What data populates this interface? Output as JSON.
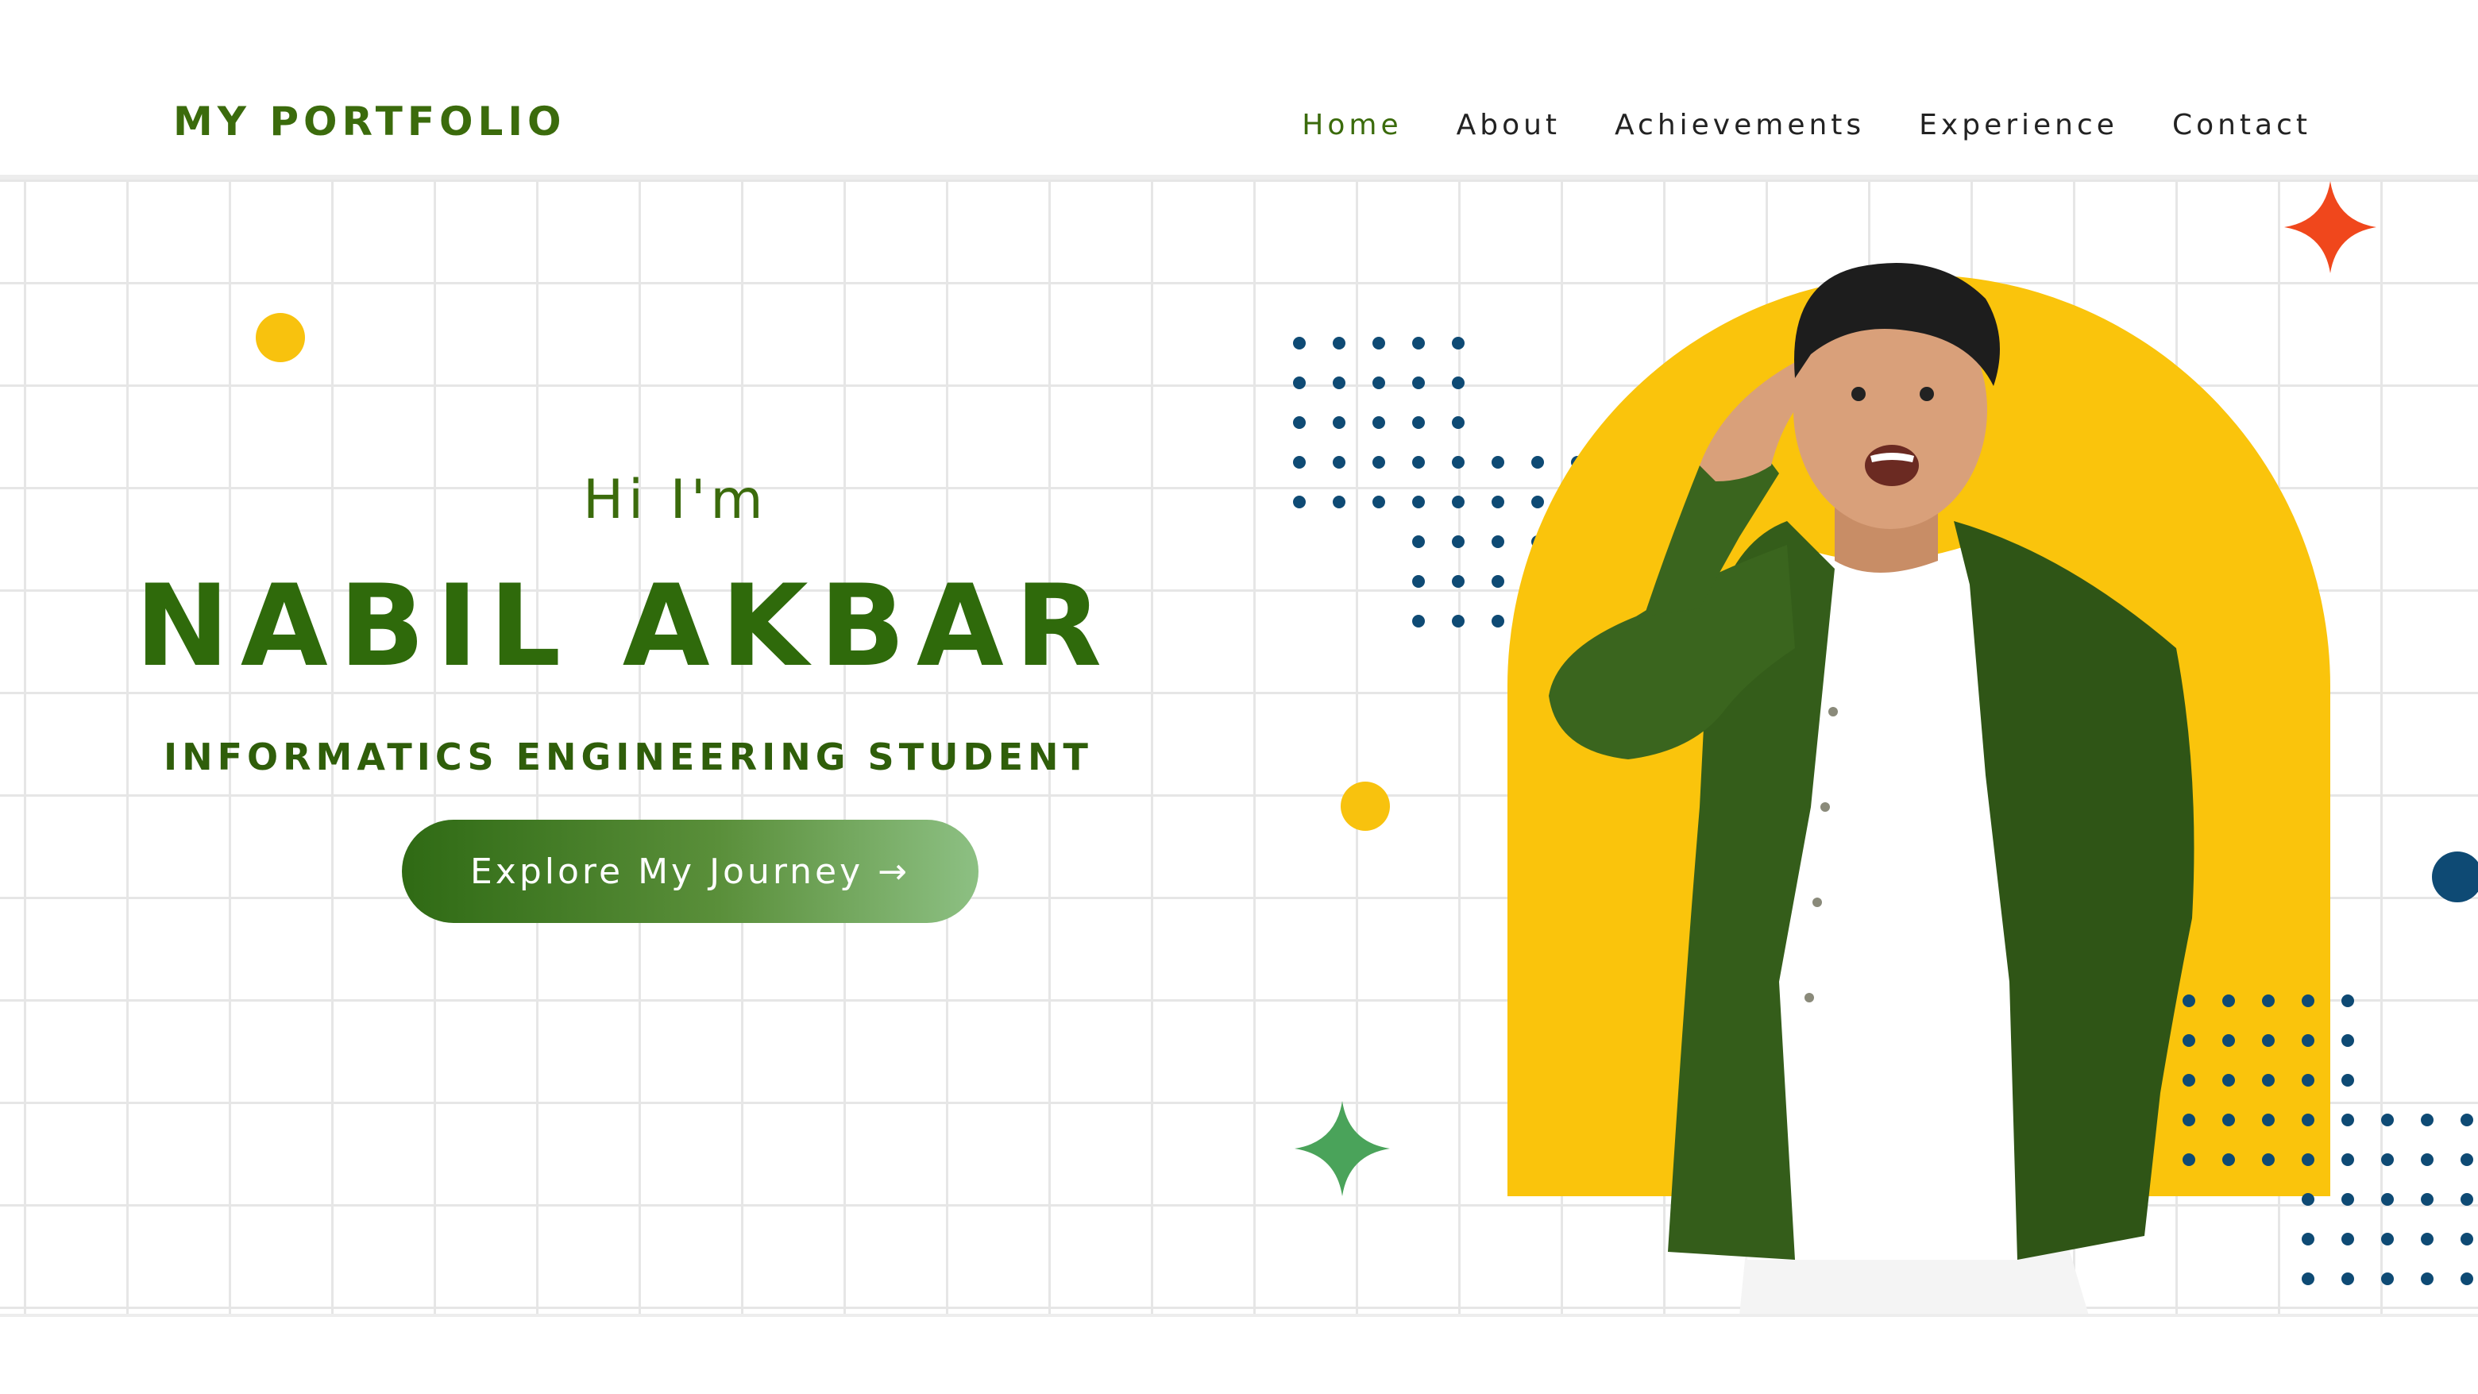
{
  "navbar": {
    "brand": "MY PORTFOLIO",
    "links": [
      {
        "label": "Home",
        "active": true
      },
      {
        "label": "About",
        "active": false
      },
      {
        "label": "Achievements",
        "active": false
      },
      {
        "label": "Experience",
        "active": false
      },
      {
        "label": "Contact",
        "active": false
      }
    ]
  },
  "hero": {
    "greeting": "Hi I'm",
    "name": "NABIL AKBAR",
    "role": "INFORMATICS ENGINEERING STUDENT",
    "cta_label": "Explore My Journey →"
  },
  "colors": {
    "brand_green": "#3b6b0c",
    "accent_yellow": "#fac40c",
    "dot_navy": "#0e4a74",
    "sparkle_orange": "#f0471c",
    "sparkle_green": "#4aa35a"
  },
  "icons": {
    "arrow": "arrow-right-icon",
    "sparkle": "four-point-star-icon"
  }
}
